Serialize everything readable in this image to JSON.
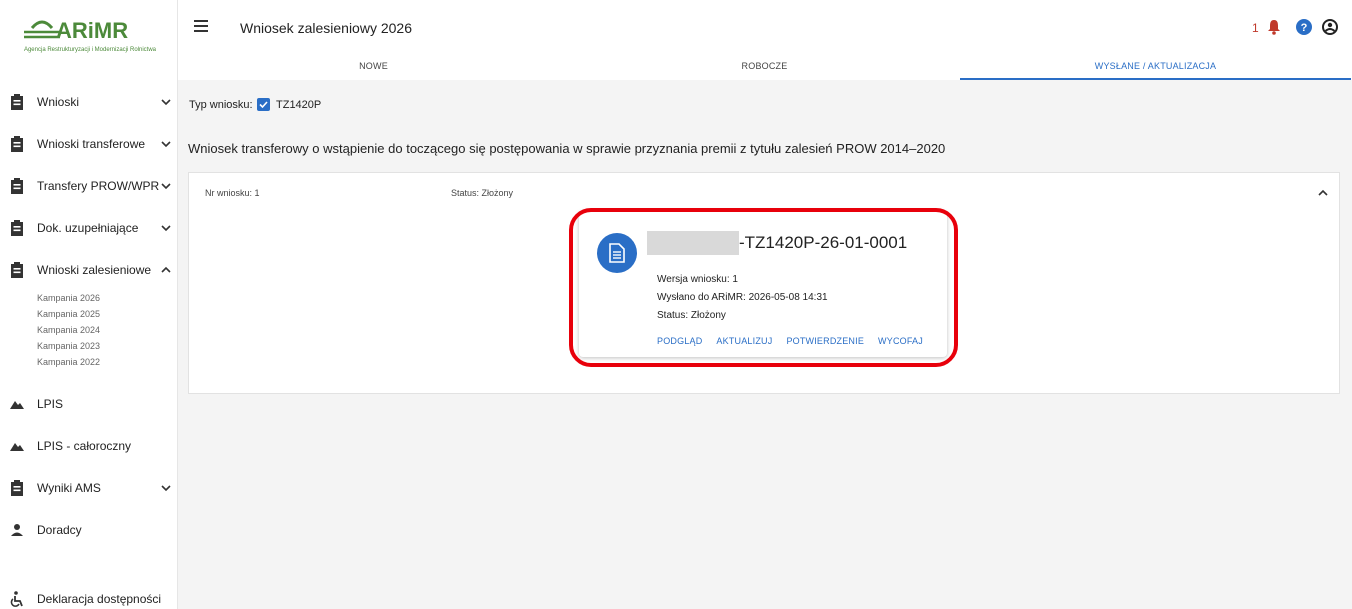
{
  "logo": {
    "name": "ARiMR",
    "subtitle": "Agencja Restrukturyzacji i Modernizacji Rolnictwa",
    "color": "#4c8a3a"
  },
  "sidebar": {
    "items": [
      {
        "label": "Wnioski",
        "icon": "clipboard-icon",
        "expandable": true,
        "expanded": false
      },
      {
        "label": "Wnioski transferowe",
        "icon": "clipboard-icon",
        "expandable": true,
        "expanded": false
      },
      {
        "label": "Transfery PROW/WPR",
        "icon": "clipboard-icon",
        "expandable": true,
        "expanded": false
      },
      {
        "label": "Dok. uzupełniające",
        "icon": "clipboard-icon",
        "expandable": true,
        "expanded": false
      },
      {
        "label": "Wnioski zalesieniowe",
        "icon": "clipboard-icon",
        "expandable": true,
        "expanded": true
      },
      {
        "label": "LPIS",
        "icon": "terrain-icon",
        "expandable": false
      },
      {
        "label": "LPIS - całoroczny",
        "icon": "terrain-icon",
        "expandable": false
      },
      {
        "label": "Wyniki AMS",
        "icon": "clipboard-icon",
        "expandable": true,
        "expanded": false
      },
      {
        "label": "Doradcy",
        "icon": "person-icon",
        "expandable": false
      },
      {
        "label": "Deklaracja dostępności",
        "icon": "accessibility-icon",
        "expandable": false
      }
    ],
    "subitems": [
      "Kampania 2026",
      "Kampania 2025",
      "Kampania 2024",
      "Kampania 2023",
      "Kampania 2022"
    ]
  },
  "header": {
    "title": "Wniosek zalesieniowy 2026",
    "notification_count": "1",
    "tabs": [
      {
        "label": "NOWE",
        "active": false
      },
      {
        "label": "ROBOCZE",
        "active": false
      },
      {
        "label": "WYSŁANE / AKTUALIZACJA",
        "active": true
      }
    ]
  },
  "main": {
    "type_label": "Typ wniosku:",
    "type_value": "TZ1420P",
    "description": "Wniosek transferowy o wstąpienie do toczącego się postępowania w sprawie przyznania premii z tytułu zalesień PROW 2014–2020",
    "panel": {
      "nr_label": "Nr wniosku: 1",
      "status_label": "Status: Złożony",
      "card": {
        "number_suffix": "-TZ1420P-26-01-0001",
        "version": "Wersja wniosku: 1",
        "sent": "Wysłano do ARiMR: 2026-05-08 14:31",
        "status": "Status: Złożony",
        "actions": [
          "PODGLĄD",
          "AKTUALIZUJ",
          "POTWIERDZENIE",
          "WYCOFAJ"
        ]
      }
    }
  },
  "colors": {
    "accent": "#2a6ec6",
    "highlight": "#e8000b",
    "alert": "#c0392b",
    "logo": "#4c8a3a"
  }
}
